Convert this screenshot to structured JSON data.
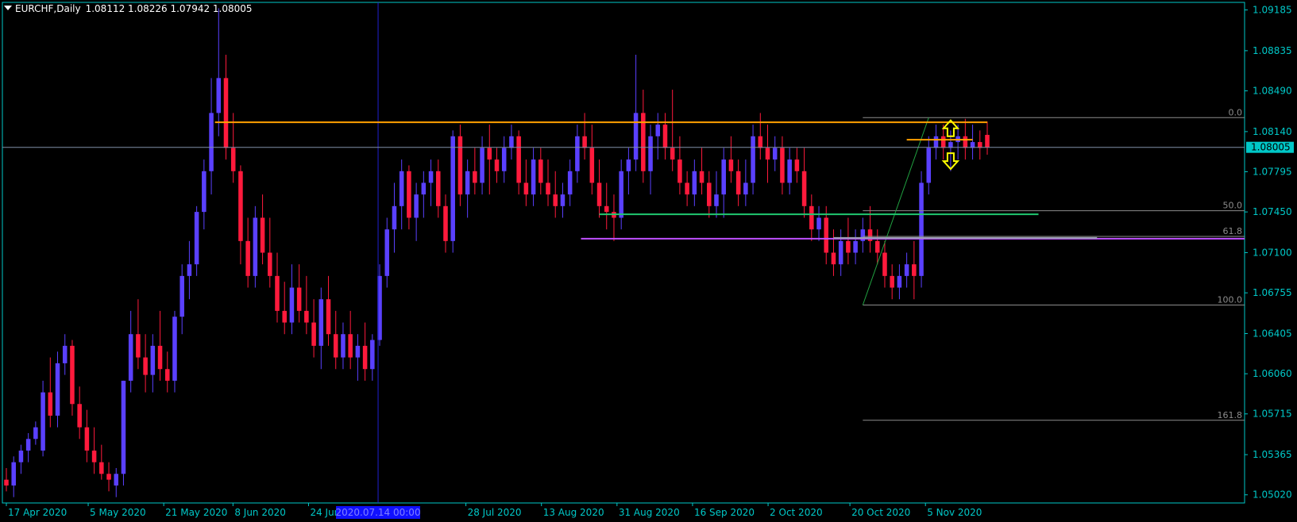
{
  "header": {
    "symbol": "EURCHF,Daily",
    "ohlc": "1.08112 1.08226 1.07942 1.08005"
  },
  "price_badge": "1.08005",
  "crosshair_label": "2020.07.14 00:00",
  "fib_labels": [
    "0.0",
    "50.0",
    "61.8",
    "100.0",
    "161.8"
  ],
  "colors": {
    "background": "#000000",
    "axis": "#00c8c8",
    "bull": "#5a40ff",
    "bear": "#ff1a3c",
    "resistance": "#ffa000",
    "support_green": "#20c870",
    "support_purple": "#c050ff",
    "fib": "#8c8c8c",
    "arrow": "#ffff00"
  },
  "chart_data": {
    "type": "candlestick",
    "yticks": [
      "1.09185",
      "1.08835",
      "1.08490",
      "1.08140",
      "1.07795",
      "1.07450",
      "1.07100",
      "1.06755",
      "1.06405",
      "1.06060",
      "1.05715",
      "1.05365",
      "1.05020"
    ],
    "xticks": [
      "17 Apr 2020",
      "5 May 2020",
      "21 May 2020",
      "8 Jun 2020",
      "24 Jun 2020",
      "28 Jul 2020",
      "13 Aug 2020",
      "31 Aug 2020",
      "16 Sep 2020",
      "2 Oct 2020",
      "20 Oct 2020",
      "5 Nov 2020"
    ],
    "ohlc": [
      [
        1.0515,
        1.0525,
        1.0505,
        1.051
      ],
      [
        1.051,
        1.0535,
        1.05,
        1.053
      ],
      [
        1.053,
        1.0545,
        1.052,
        1.054
      ],
      [
        1.054,
        1.0555,
        1.053,
        1.055
      ],
      [
        1.055,
        1.0565,
        1.0545,
        1.056
      ],
      [
        1.054,
        1.06,
        1.0535,
        1.059
      ],
      [
        1.059,
        1.062,
        1.056,
        1.057
      ],
      [
        1.057,
        1.0625,
        1.056,
        1.0615
      ],
      [
        1.0615,
        1.064,
        1.0605,
        1.063
      ],
      [
        1.063,
        1.0635,
        1.057,
        1.058
      ],
      [
        1.058,
        1.0595,
        1.055,
        1.056
      ],
      [
        1.056,
        1.0575,
        1.053,
        1.054
      ],
      [
        1.054,
        1.056,
        1.052,
        1.053
      ],
      [
        1.053,
        1.0545,
        1.0515,
        1.052
      ],
      [
        1.052,
        1.053,
        1.0505,
        1.0515
      ],
      [
        1.051,
        1.0525,
        1.05,
        1.052
      ],
      [
        1.052,
        1.06,
        1.051,
        1.06
      ],
      [
        1.06,
        1.066,
        1.059,
        1.064
      ],
      [
        1.064,
        1.067,
        1.061,
        1.062
      ],
      [
        1.062,
        1.064,
        1.059,
        1.0605
      ],
      [
        1.0605,
        1.064,
        1.059,
        1.063
      ],
      [
        1.063,
        1.066,
        1.06,
        1.061
      ],
      [
        1.061,
        1.0625,
        1.059,
        1.06
      ],
      [
        1.06,
        1.066,
        1.059,
        1.0655
      ],
      [
        1.0655,
        1.07,
        1.064,
        1.069
      ],
      [
        1.069,
        1.072,
        1.067,
        1.07
      ],
      [
        1.07,
        1.075,
        1.069,
        1.0745
      ],
      [
        1.0745,
        1.079,
        1.073,
        1.078
      ],
      [
        1.078,
        1.086,
        1.076,
        1.083
      ],
      [
        1.083,
        1.092,
        1.081,
        1.086
      ],
      [
        1.086,
        1.088,
        1.079,
        1.08
      ],
      [
        1.08,
        1.083,
        1.077,
        1.078
      ],
      [
        1.078,
        1.0785,
        1.07,
        1.072
      ],
      [
        1.072,
        1.074,
        1.068,
        1.069
      ],
      [
        1.069,
        1.075,
        1.068,
        1.074
      ],
      [
        1.074,
        1.076,
        1.07,
        1.071
      ],
      [
        1.071,
        1.074,
        1.068,
        1.069
      ],
      [
        1.069,
        1.071,
        1.065,
        1.066
      ],
      [
        1.066,
        1.0685,
        1.064,
        1.065
      ],
      [
        1.065,
        1.07,
        1.064,
        1.068
      ],
      [
        1.068,
        1.07,
        1.065,
        1.066
      ],
      [
        1.066,
        1.069,
        1.064,
        1.065
      ],
      [
        1.065,
        1.067,
        1.062,
        1.063
      ],
      [
        1.063,
        1.068,
        1.061,
        1.067
      ],
      [
        1.067,
        1.069,
        1.063,
        1.064
      ],
      [
        1.064,
        1.066,
        1.061,
        1.062
      ],
      [
        1.062,
        1.065,
        1.061,
        1.064
      ],
      [
        1.064,
        1.066,
        1.061,
        1.062
      ],
      [
        1.062,
        1.064,
        1.06,
        1.063
      ],
      [
        1.063,
        1.065,
        1.06,
        1.061
      ],
      [
        1.061,
        1.064,
        1.06,
        1.0635
      ],
      [
        1.0635,
        1.07,
        1.063,
        1.069
      ],
      [
        1.069,
        1.074,
        1.068,
        1.073
      ],
      [
        1.073,
        1.077,
        1.071,
        1.075
      ],
      [
        1.075,
        1.079,
        1.073,
        1.078
      ],
      [
        1.078,
        1.0785,
        1.073,
        1.074
      ],
      [
        1.074,
        1.077,
        1.072,
        1.076
      ],
      [
        1.076,
        1.078,
        1.074,
        1.077
      ],
      [
        1.077,
        1.079,
        1.075,
        1.078
      ],
      [
        1.078,
        1.079,
        1.074,
        1.075
      ],
      [
        1.075,
        1.076,
        1.071,
        1.072
      ],
      [
        1.072,
        1.0815,
        1.071,
        1.081
      ],
      [
        1.081,
        1.082,
        1.075,
        1.076
      ],
      [
        1.076,
        1.079,
        1.074,
        1.078
      ],
      [
        1.078,
        1.08,
        1.076,
        1.077
      ],
      [
        1.077,
        1.081,
        1.076,
        1.08
      ],
      [
        1.08,
        1.082,
        1.076,
        1.079
      ],
      [
        1.079,
        1.08,
        1.077,
        1.078
      ],
      [
        1.078,
        1.081,
        1.077,
        1.08
      ],
      [
        1.08,
        1.082,
        1.079,
        1.081
      ],
      [
        1.081,
        1.0815,
        1.076,
        1.077
      ],
      [
        1.077,
        1.079,
        1.075,
        1.076
      ],
      [
        1.076,
        1.08,
        1.075,
        1.079
      ],
      [
        1.079,
        1.08,
        1.076,
        1.077
      ],
      [
        1.077,
        1.079,
        1.075,
        1.076
      ],
      [
        1.076,
        1.078,
        1.074,
        1.075
      ],
      [
        1.075,
        1.077,
        1.074,
        1.076
      ],
      [
        1.076,
        1.079,
        1.075,
        1.078
      ],
      [
        1.078,
        1.082,
        1.077,
        1.081
      ],
      [
        1.081,
        1.083,
        1.079,
        1.08
      ],
      [
        1.08,
        1.082,
        1.076,
        1.077
      ],
      [
        1.077,
        1.079,
        1.074,
        1.075
      ],
      [
        1.075,
        1.077,
        1.073,
        1.0745
      ],
      [
        1.0745,
        1.076,
        1.072,
        1.074
      ],
      [
        1.074,
        1.079,
        1.073,
        1.078
      ],
      [
        1.078,
        1.08,
        1.076,
        1.079
      ],
      [
        1.079,
        1.088,
        1.078,
        1.083
      ],
      [
        1.083,
        1.085,
        1.077,
        1.078
      ],
      [
        1.078,
        1.082,
        1.076,
        1.081
      ],
      [
        1.081,
        1.083,
        1.079,
        1.082
      ],
      [
        1.082,
        1.083,
        1.079,
        1.08
      ],
      [
        1.08,
        1.085,
        1.078,
        1.079
      ],
      [
        1.079,
        1.081,
        1.076,
        1.077
      ],
      [
        1.077,
        1.078,
        1.075,
        1.076
      ],
      [
        1.076,
        1.079,
        1.075,
        1.078
      ],
      [
        1.078,
        1.08,
        1.076,
        1.077
      ],
      [
        1.077,
        1.078,
        1.074,
        1.075
      ],
      [
        1.075,
        1.078,
        1.074,
        1.076
      ],
      [
        1.076,
        1.08,
        1.074,
        1.079
      ],
      [
        1.079,
        1.081,
        1.077,
        1.078
      ],
      [
        1.078,
        1.079,
        1.075,
        1.076
      ],
      [
        1.076,
        1.079,
        1.075,
        1.077
      ],
      [
        1.077,
        1.082,
        1.076,
        1.081
      ],
      [
        1.081,
        1.083,
        1.079,
        1.08
      ],
      [
        1.08,
        1.082,
        1.077,
        1.079
      ],
      [
        1.079,
        1.081,
        1.078,
        1.08
      ],
      [
        1.08,
        1.081,
        1.076,
        1.077
      ],
      [
        1.077,
        1.08,
        1.076,
        1.079
      ],
      [
        1.079,
        1.08,
        1.077,
        1.078
      ],
      [
        1.078,
        1.08,
        1.074,
        1.075
      ],
      [
        1.075,
        1.076,
        1.072,
        1.073
      ],
      [
        1.073,
        1.075,
        1.072,
        1.074
      ],
      [
        1.074,
        1.075,
        1.07,
        1.071
      ],
      [
        1.071,
        1.073,
        1.069,
        1.07
      ],
      [
        1.07,
        1.073,
        1.069,
        1.072
      ],
      [
        1.072,
        1.074,
        1.07,
        1.071
      ],
      [
        1.071,
        1.073,
        1.07,
        1.072
      ],
      [
        1.072,
        1.074,
        1.071,
        1.073
      ],
      [
        1.073,
        1.075,
        1.071,
        1.072
      ],
      [
        1.072,
        1.073,
        1.07,
        1.071
      ],
      [
        1.071,
        1.072,
        1.068,
        1.069
      ],
      [
        1.069,
        1.07,
        1.067,
        1.068
      ],
      [
        1.068,
        1.07,
        1.067,
        1.069
      ],
      [
        1.069,
        1.071,
        1.068,
        1.07
      ],
      [
        1.07,
        1.072,
        1.067,
        1.069
      ],
      [
        1.069,
        1.078,
        1.068,
        1.077
      ],
      [
        1.077,
        1.081,
        1.076,
        1.08
      ],
      [
        1.08,
        1.082,
        1.079,
        1.081
      ],
      [
        1.081,
        1.082,
        1.079,
        1.08
      ],
      [
        1.08,
        1.0815,
        1.078,
        1.0805
      ],
      [
        1.0805,
        1.082,
        1.079,
        1.081
      ],
      [
        1.081,
        1.0825,
        1.079,
        1.08
      ],
      [
        1.08,
        1.082,
        1.079,
        1.0805
      ],
      [
        1.0805,
        1.0815,
        1.079,
        1.08
      ],
      [
        1.08112,
        1.08226,
        1.07942,
        1.08005
      ]
    ],
    "levels": [
      {
        "value": 1.0822
      },
      {
        "value": 1.0743
      },
      {
        "value": 1.0722
      },
      {
        "value": 1.08005
      }
    ],
    "fib_levels": [
      {
        "label": "0.0",
        "value": 1.0826
      },
      {
        "label": "50.0",
        "value": 1.0746
      },
      {
        "label": "61.8",
        "value": 1.0724
      },
      {
        "label": "100.0",
        "value": 1.0665
      },
      {
        "label": "161.8",
        "value": 1.0566
      }
    ],
    "ylim": [
      1.0495,
      1.0925
    ],
    "grid": false,
    "legend": "none"
  }
}
